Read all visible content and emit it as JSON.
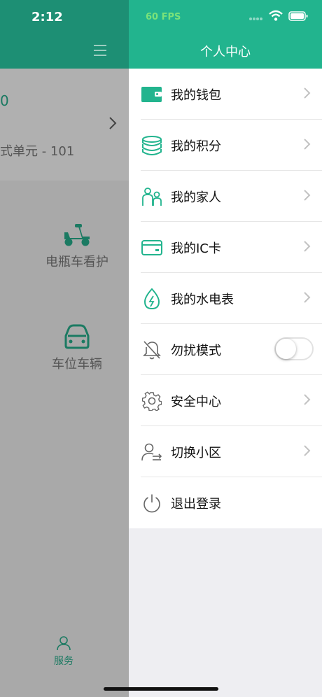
{
  "status_bar": {
    "time": "2:12",
    "fps": "60 FPS"
  },
  "background_page": {
    "card": {
      "number_fragment": "0",
      "address_fragment": "式单元 - 101"
    },
    "services": [
      {
        "label": "电瓶车看护",
        "icon": "electric-scooter-icon"
      },
      {
        "label": "车位车辆",
        "icon": "car-icon"
      }
    ],
    "tab_bar": {
      "active_tab_label": "服务"
    }
  },
  "drawer": {
    "title": "个人中心",
    "items": [
      {
        "label": "我的钱包",
        "icon": "wallet-icon",
        "accessory": "chevron"
      },
      {
        "label": "我的积分",
        "icon": "coins-icon",
        "accessory": "chevron"
      },
      {
        "label": "我的家人",
        "icon": "family-icon",
        "accessory": "chevron"
      },
      {
        "label": "我的IC卡",
        "icon": "card-icon",
        "accessory": "chevron"
      },
      {
        "label": "我的水电表",
        "icon": "water-electric-meter-icon",
        "accessory": "chevron"
      },
      {
        "label": "勿扰模式",
        "icon": "bell-off-icon",
        "accessory": "toggle",
        "toggle_on": false
      },
      {
        "label": "安全中心",
        "icon": "gear-icon",
        "accessory": "chevron"
      },
      {
        "label": "切换小区",
        "icon": "switch-user-icon",
        "accessory": "chevron"
      },
      {
        "label": "退出登录",
        "icon": "power-icon",
        "accessory": "none"
      }
    ]
  },
  "colors": {
    "brand": "#22b48e",
    "overlay_header": "#1d8f74"
  }
}
